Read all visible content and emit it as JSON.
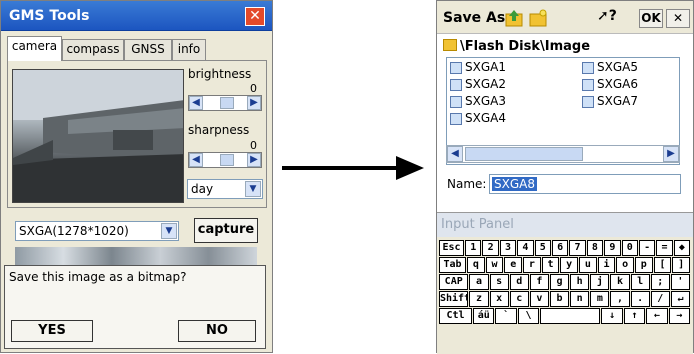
{
  "left_window": {
    "title": "GMS Tools",
    "close_glyph": "✕",
    "tabs": [
      "camera",
      "compass",
      "GNSS",
      "info"
    ],
    "brightness": {
      "label": "brightness",
      "value": "0"
    },
    "sharpness": {
      "label": "sharpness",
      "value": "0"
    },
    "scene_mode": "day",
    "resolution": "SXGA(1278*1020)",
    "capture_label": "capture",
    "dialog": {
      "message": "Save this image as a bitmap?",
      "yes": "YES",
      "no": "NO"
    }
  },
  "right_window": {
    "title": "Save As",
    "help_glyph": "?",
    "ok": "OK",
    "close_glyph": "✕",
    "path": "\\Flash Disk\\Image",
    "files": [
      "SXGA1",
      "SXGA2",
      "SXGA3",
      "SXGA4",
      "SXGA5",
      "SXGA6",
      "SXGA7"
    ],
    "name_label": "Name:",
    "name_value": "SXGA8",
    "input_panel": {
      "title": "Input Panel",
      "rows": [
        [
          "Esc",
          "1",
          "2",
          "3",
          "4",
          "5",
          "6",
          "7",
          "8",
          "9",
          "0",
          "-",
          "=",
          "◆"
        ],
        [
          "Tab",
          "q",
          "w",
          "e",
          "r",
          "t",
          "y",
          "u",
          "i",
          "o",
          "p",
          "[",
          "]"
        ],
        [
          "CAP",
          "a",
          "s",
          "d",
          "f",
          "g",
          "h",
          "j",
          "k",
          "l",
          ";",
          "'"
        ],
        [
          "Shift",
          "z",
          "x",
          "c",
          "v",
          "b",
          "n",
          "m",
          ",",
          ".",
          "/",
          "↵"
        ],
        [
          "Ctl",
          "áü",
          "`",
          "\\",
          "",
          "↓",
          "↑",
          "←",
          "→"
        ]
      ]
    }
  },
  "colors": {
    "titlebar": "#2a66cc",
    "selection": "#316ac5",
    "close": "#e34a2b"
  }
}
